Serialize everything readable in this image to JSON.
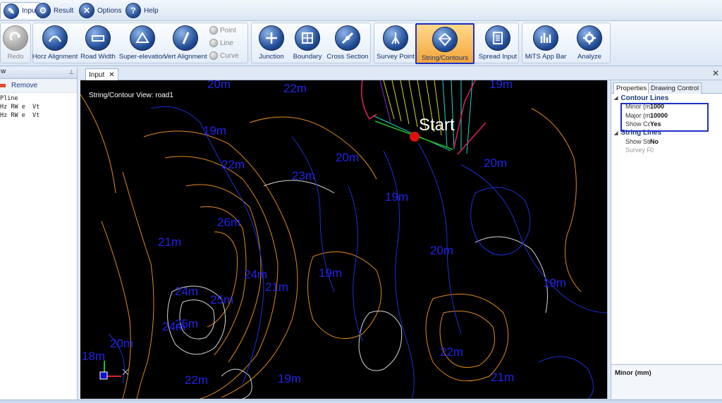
{
  "menu": {
    "tabs": [
      {
        "label": "Input",
        "icon": "input-icon"
      },
      {
        "label": "Result",
        "icon": "result-icon"
      },
      {
        "label": "Options",
        "icon": "options-icon"
      },
      {
        "label": "Help",
        "icon": "help-icon"
      }
    ]
  },
  "ribbon": {
    "redo": "Redo",
    "horz_alignment": "Horz Alignment",
    "road_width": "Road Width",
    "super_elevation": "Super-elevation",
    "vert_alignment": "Vert Alignment",
    "point": "Point",
    "line": "Line",
    "curve": "Curve",
    "junction": "Junction",
    "boundary": "Boundary",
    "cross_section": "Cross Section",
    "survey_point": "Survey Point",
    "string_contours": "String/Contours",
    "spread_input": "Spread Input",
    "mits_app_bar": "MiTS App Bar",
    "analyze": "Analyze"
  },
  "left_panel": {
    "header": "w",
    "remove": "Remove",
    "items": [
      "Pline",
      "Hz RW e  Vt",
      "Hz RW e  Vt"
    ]
  },
  "document": {
    "tab_label": "Input",
    "view_title": "String/Contour View: road1",
    "start_label": "Start",
    "contour_labels": [
      "20m",
      "22m",
      "19m",
      "19m",
      "20m",
      "22m",
      "23m",
      "19m",
      "20m",
      "26m",
      "21m",
      "20m",
      "24m",
      "21m",
      "19m",
      "19m",
      "24m",
      "25m",
      "24m",
      "25m",
      "20m",
      "18m",
      "22m",
      "19m",
      "22m",
      "21m"
    ]
  },
  "properties": {
    "tabs": [
      "Properties",
      "Drawing Control"
    ],
    "sections": [
      {
        "title": "Contour Lines",
        "rows": [
          {
            "key": "Minor (mm)",
            "value": "1000"
          },
          {
            "key": "Major (mm)",
            "value": "10000"
          },
          {
            "key": "Show Contou",
            "value": "Yes"
          }
        ]
      },
      {
        "title": "String Lines",
        "rows": [
          {
            "key": "Show String",
            "value": "No"
          },
          {
            "key": "Survey Point",
            "value": "0"
          }
        ]
      }
    ],
    "description_title": "Minor (mm)"
  },
  "colors": {
    "selected_button": "#f3a53a",
    "highlight_border": "#1e32c8",
    "contour_label": "#2323e6",
    "canvas_bg": "#000000"
  }
}
